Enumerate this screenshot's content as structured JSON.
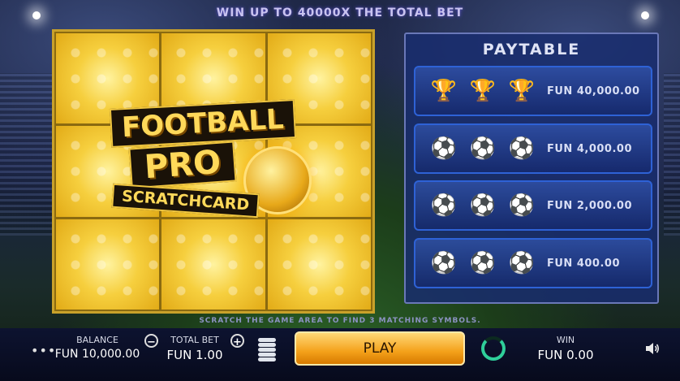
{
  "banner": "WIN UP TO 40000X THE TOTAL BET",
  "logo": {
    "line1": "FOOTBALL",
    "line2": "PRO",
    "line3": "SCRATCHCARD"
  },
  "paytable": {
    "title": "PAYTABLE",
    "rows": [
      {
        "symbol": "trophy-icon",
        "glyph": "🏆",
        "value": "FUN 40,000.00"
      },
      {
        "symbol": "player-red-icon",
        "glyph": "⚽",
        "value": "FUN 4,000.00"
      },
      {
        "symbol": "player-white-icon",
        "glyph": "⚽",
        "value": "FUN 2,000.00"
      },
      {
        "symbol": "player-teal-icon",
        "glyph": "⚽",
        "value": "FUN 400.00"
      }
    ]
  },
  "instructions": "SCRATCH THE GAME AREA TO FIND 3 MATCHING SYMBOLS.",
  "bottom": {
    "menu": "•••",
    "balance_label": "BALANCE",
    "balance_value": "FUN 10,000.00",
    "bet_label": "TOTAL BET",
    "bet_value": "FUN 1.00",
    "minus": "−",
    "plus": "+",
    "play_label": "PLAY",
    "win_label": "WIN",
    "win_value": "FUN 0.00"
  },
  "colors": {
    "accent": "#f4a11a",
    "panel": "#1c2e6e",
    "row_border": "#2e62d6"
  }
}
